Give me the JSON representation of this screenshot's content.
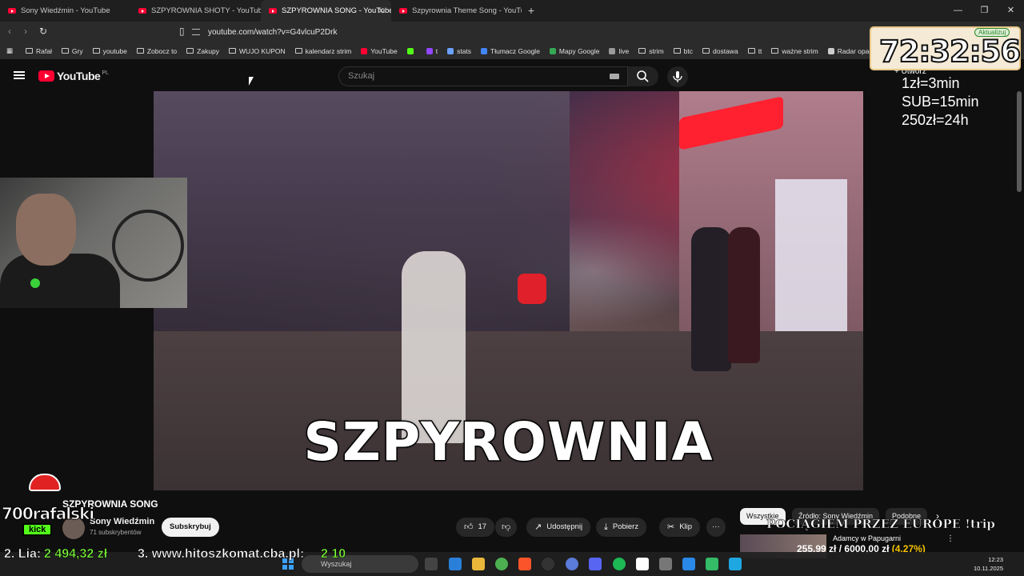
{
  "browser": {
    "tabs": [
      {
        "label": "Sony Wiedźmin - YouTube",
        "active": false
      },
      {
        "label": "SZPYROWNIA SHOTY - YouTube",
        "active": false
      },
      {
        "label": "SZPYROWNIA SONG - YouTube",
        "active": true
      },
      {
        "label": "Szpyrownia Theme Song - YouTube",
        "active": false
      }
    ],
    "url": "youtube.com/watch?v=G4vlcuP2Drk",
    "update_label": "Aktualizuj"
  },
  "bookmarks": [
    "Rafał",
    "Gry",
    "youtube",
    "Zobocz to",
    "Zakupy",
    "WUJO KUPON",
    "kalendarz strim",
    "YouTube",
    "",
    "t",
    "stats",
    "Tłumacz Google",
    "Mapy Google",
    "live",
    "strim",
    "btc",
    "dostawa",
    "tt",
    "ważne strim",
    "Radar opadów"
  ],
  "youtube": {
    "logo": "YouTube",
    "region": "PL",
    "search_placeholder": "Szukaj",
    "create_label": "Utwórz",
    "video_caption": "SZPYROWNIA",
    "video_title": "SZPYROWNIA SONG",
    "channel": {
      "name": "Sony Wiedźmin",
      "subs": "71 subskrybentów"
    },
    "subscribe_label": "Subskrybuj",
    "likes": "17",
    "share_label": "Udostępnij",
    "download_label": "Pobierz",
    "clip_label": "Klip",
    "chips": [
      "Wszystkie",
      "Źródło: Sony Wiedźmin",
      "Podobne"
    ],
    "related_title": "Adamcy w Papugarni"
  },
  "overlay": {
    "timer": "72:32:56",
    "rules": [
      "1zł=3min",
      "SUB=15min",
      "250zł=24h"
    ],
    "promo": "POCIĄGIEM PRZEZ EUROPE !trip",
    "donation_raised": "255,99 zł",
    "donation_goal": "6000,00 zł",
    "donation_pct": "(4.27%)",
    "ticker_1_label": "2. Lia:",
    "ticker_1_amount": "2 494,32 zł",
    "ticker_2_label": "3. www.hitoszkomat.cba.pl:",
    "ticker_2_amount": "2 10",
    "streamer": "700rafalski",
    "platform": "kick"
  },
  "taskbar": {
    "search_placeholder": "Wyszukaj",
    "time": "12:23",
    "date": "10.11.2025"
  }
}
